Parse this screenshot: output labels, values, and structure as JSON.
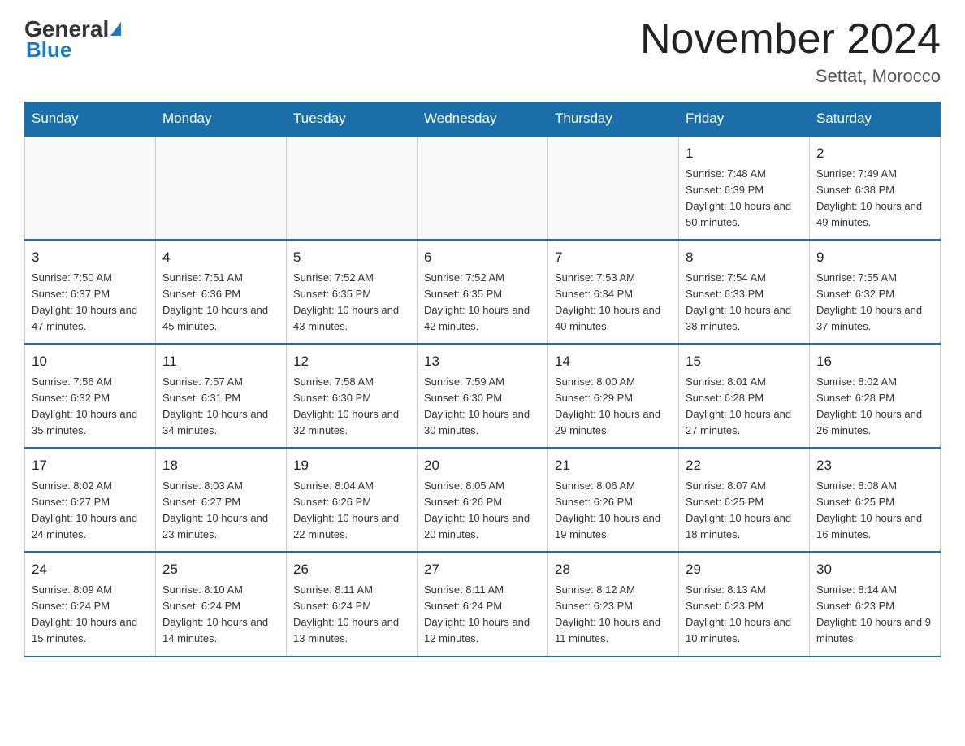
{
  "header": {
    "logo_general": "General",
    "logo_blue": "Blue",
    "month_title": "November 2024",
    "location": "Settat, Morocco"
  },
  "days_of_week": [
    "Sunday",
    "Monday",
    "Tuesday",
    "Wednesday",
    "Thursday",
    "Friday",
    "Saturday"
  ],
  "weeks": [
    [
      {
        "day": "",
        "sunrise": "",
        "sunset": "",
        "daylight": ""
      },
      {
        "day": "",
        "sunrise": "",
        "sunset": "",
        "daylight": ""
      },
      {
        "day": "",
        "sunrise": "",
        "sunset": "",
        "daylight": ""
      },
      {
        "day": "",
        "sunrise": "",
        "sunset": "",
        "daylight": ""
      },
      {
        "day": "",
        "sunrise": "",
        "sunset": "",
        "daylight": ""
      },
      {
        "day": "1",
        "sunrise": "Sunrise: 7:48 AM",
        "sunset": "Sunset: 6:39 PM",
        "daylight": "Daylight: 10 hours and 50 minutes."
      },
      {
        "day": "2",
        "sunrise": "Sunrise: 7:49 AM",
        "sunset": "Sunset: 6:38 PM",
        "daylight": "Daylight: 10 hours and 49 minutes."
      }
    ],
    [
      {
        "day": "3",
        "sunrise": "Sunrise: 7:50 AM",
        "sunset": "Sunset: 6:37 PM",
        "daylight": "Daylight: 10 hours and 47 minutes."
      },
      {
        "day": "4",
        "sunrise": "Sunrise: 7:51 AM",
        "sunset": "Sunset: 6:36 PM",
        "daylight": "Daylight: 10 hours and 45 minutes."
      },
      {
        "day": "5",
        "sunrise": "Sunrise: 7:52 AM",
        "sunset": "Sunset: 6:35 PM",
        "daylight": "Daylight: 10 hours and 43 minutes."
      },
      {
        "day": "6",
        "sunrise": "Sunrise: 7:52 AM",
        "sunset": "Sunset: 6:35 PM",
        "daylight": "Daylight: 10 hours and 42 minutes."
      },
      {
        "day": "7",
        "sunrise": "Sunrise: 7:53 AM",
        "sunset": "Sunset: 6:34 PM",
        "daylight": "Daylight: 10 hours and 40 minutes."
      },
      {
        "day": "8",
        "sunrise": "Sunrise: 7:54 AM",
        "sunset": "Sunset: 6:33 PM",
        "daylight": "Daylight: 10 hours and 38 minutes."
      },
      {
        "day": "9",
        "sunrise": "Sunrise: 7:55 AM",
        "sunset": "Sunset: 6:32 PM",
        "daylight": "Daylight: 10 hours and 37 minutes."
      }
    ],
    [
      {
        "day": "10",
        "sunrise": "Sunrise: 7:56 AM",
        "sunset": "Sunset: 6:32 PM",
        "daylight": "Daylight: 10 hours and 35 minutes."
      },
      {
        "day": "11",
        "sunrise": "Sunrise: 7:57 AM",
        "sunset": "Sunset: 6:31 PM",
        "daylight": "Daylight: 10 hours and 34 minutes."
      },
      {
        "day": "12",
        "sunrise": "Sunrise: 7:58 AM",
        "sunset": "Sunset: 6:30 PM",
        "daylight": "Daylight: 10 hours and 32 minutes."
      },
      {
        "day": "13",
        "sunrise": "Sunrise: 7:59 AM",
        "sunset": "Sunset: 6:30 PM",
        "daylight": "Daylight: 10 hours and 30 minutes."
      },
      {
        "day": "14",
        "sunrise": "Sunrise: 8:00 AM",
        "sunset": "Sunset: 6:29 PM",
        "daylight": "Daylight: 10 hours and 29 minutes."
      },
      {
        "day": "15",
        "sunrise": "Sunrise: 8:01 AM",
        "sunset": "Sunset: 6:28 PM",
        "daylight": "Daylight: 10 hours and 27 minutes."
      },
      {
        "day": "16",
        "sunrise": "Sunrise: 8:02 AM",
        "sunset": "Sunset: 6:28 PM",
        "daylight": "Daylight: 10 hours and 26 minutes."
      }
    ],
    [
      {
        "day": "17",
        "sunrise": "Sunrise: 8:02 AM",
        "sunset": "Sunset: 6:27 PM",
        "daylight": "Daylight: 10 hours and 24 minutes."
      },
      {
        "day": "18",
        "sunrise": "Sunrise: 8:03 AM",
        "sunset": "Sunset: 6:27 PM",
        "daylight": "Daylight: 10 hours and 23 minutes."
      },
      {
        "day": "19",
        "sunrise": "Sunrise: 8:04 AM",
        "sunset": "Sunset: 6:26 PM",
        "daylight": "Daylight: 10 hours and 22 minutes."
      },
      {
        "day": "20",
        "sunrise": "Sunrise: 8:05 AM",
        "sunset": "Sunset: 6:26 PM",
        "daylight": "Daylight: 10 hours and 20 minutes."
      },
      {
        "day": "21",
        "sunrise": "Sunrise: 8:06 AM",
        "sunset": "Sunset: 6:26 PM",
        "daylight": "Daylight: 10 hours and 19 minutes."
      },
      {
        "day": "22",
        "sunrise": "Sunrise: 8:07 AM",
        "sunset": "Sunset: 6:25 PM",
        "daylight": "Daylight: 10 hours and 18 minutes."
      },
      {
        "day": "23",
        "sunrise": "Sunrise: 8:08 AM",
        "sunset": "Sunset: 6:25 PM",
        "daylight": "Daylight: 10 hours and 16 minutes."
      }
    ],
    [
      {
        "day": "24",
        "sunrise": "Sunrise: 8:09 AM",
        "sunset": "Sunset: 6:24 PM",
        "daylight": "Daylight: 10 hours and 15 minutes."
      },
      {
        "day": "25",
        "sunrise": "Sunrise: 8:10 AM",
        "sunset": "Sunset: 6:24 PM",
        "daylight": "Daylight: 10 hours and 14 minutes."
      },
      {
        "day": "26",
        "sunrise": "Sunrise: 8:11 AM",
        "sunset": "Sunset: 6:24 PM",
        "daylight": "Daylight: 10 hours and 13 minutes."
      },
      {
        "day": "27",
        "sunrise": "Sunrise: 8:11 AM",
        "sunset": "Sunset: 6:24 PM",
        "daylight": "Daylight: 10 hours and 12 minutes."
      },
      {
        "day": "28",
        "sunrise": "Sunrise: 8:12 AM",
        "sunset": "Sunset: 6:23 PM",
        "daylight": "Daylight: 10 hours and 11 minutes."
      },
      {
        "day": "29",
        "sunrise": "Sunrise: 8:13 AM",
        "sunset": "Sunset: 6:23 PM",
        "daylight": "Daylight: 10 hours and 10 minutes."
      },
      {
        "day": "30",
        "sunrise": "Sunrise: 8:14 AM",
        "sunset": "Sunset: 6:23 PM",
        "daylight": "Daylight: 10 hours and 9 minutes."
      }
    ]
  ]
}
